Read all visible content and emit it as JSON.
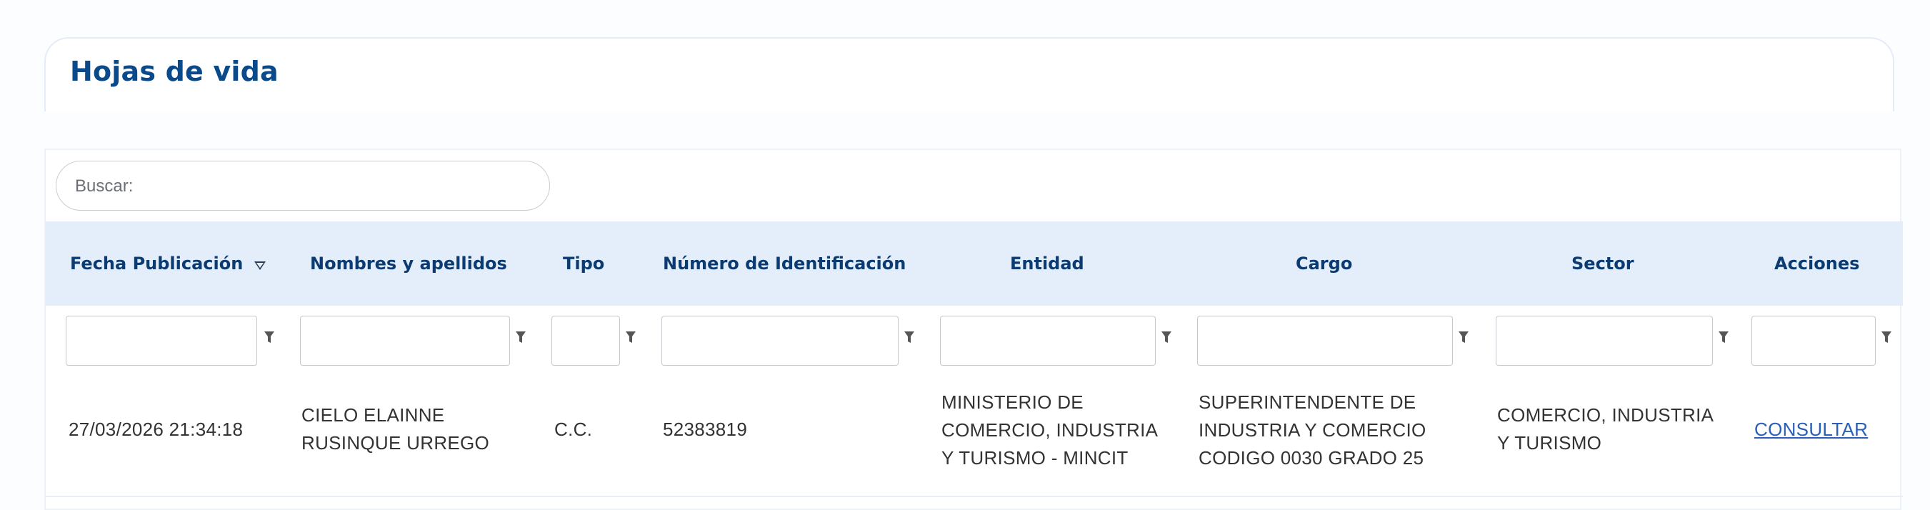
{
  "page": {
    "title": "Hojas de vida"
  },
  "search": {
    "placeholder": "Buscar:"
  },
  "table": {
    "columns": [
      {
        "key": "fecha",
        "label": "Fecha Publicación",
        "sorted": "desc"
      },
      {
        "key": "nombres",
        "label": "Nombres y apellidos"
      },
      {
        "key": "tipo",
        "label": "Tipo"
      },
      {
        "key": "numero",
        "label": "Número de Identificación"
      },
      {
        "key": "entidad",
        "label": "Entidad"
      },
      {
        "key": "cargo",
        "label": "Cargo"
      },
      {
        "key": "sector",
        "label": "Sector"
      },
      {
        "key": "acciones",
        "label": "Acciones"
      }
    ],
    "rows": [
      {
        "fecha": "27/03/2026 21:34:18",
        "nombres_l1": "CIELO ELAINNE",
        "nombres_l2": "RUSINQUE URREGO",
        "tipo": "C.C.",
        "numero": "52383819",
        "entidad_l1": "MINISTERIO DE",
        "entidad_l2": "COMERCIO, INDUSTRIA",
        "entidad_l3": "Y TURISMO - MINCIT",
        "cargo_l1": "SUPERINTENDENTE DE",
        "cargo_l2": "INDUSTRIA Y COMERCIO",
        "cargo_l3": "CODIGO 0030 GRADO 25",
        "sector_l1": "COMERCIO, INDUSTRIA",
        "sector_l2": "Y TURISMO",
        "accion": "CONSULTAR"
      }
    ]
  },
  "colors": {
    "accent": "#0a4a8a",
    "header_bg": "#e4eefb",
    "link": "#2a5fb8"
  },
  "icons": {
    "filter": "filter-funnel-icon",
    "sort": "sort-desc-icon"
  }
}
